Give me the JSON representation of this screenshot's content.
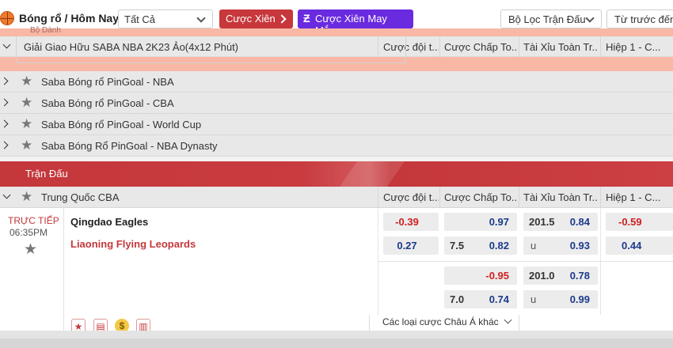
{
  "header": {
    "breadcrumb": "Bóng rổ / Hôm Nay",
    "sport_select": "Tất Cả",
    "parlay_button": "Cược Xiên",
    "lucky_parlay_button": "Cược Xiên May Mắn",
    "match_filter": "Bộ Lọc Trận Đấu",
    "sort_select": "Từ trước đến"
  },
  "expanded_league": {
    "name": "Giải Giao Hữu SABA NBA 2K23 Ảo(4x12 Phút)",
    "hint": "Bộ Dành"
  },
  "columns": [
    "Cược đội t...",
    "Cược Chấp To...",
    "Tài Xỉu Toàn Tr...",
    "Hiệp 1 - C..."
  ],
  "leagues": [
    {
      "name": "Saba Bóng rổ PinGoal - NBA"
    },
    {
      "name": "Saba Bóng rổ PinGoal - CBA"
    },
    {
      "name": "Saba Bóng rổ PinGoal - World Cup"
    },
    {
      "name": "Saba Bóng Rổ PinGoal - NBA Dynasty"
    }
  ],
  "section_title": "Trận Đấu",
  "match_league": "Trung Quốc CBA",
  "match": {
    "status": "TRỰC TIẾP",
    "time": "06:35PM",
    "home": "Qingdao Eagles",
    "away": "Liaoning Flying Leopards",
    "line1": {
      "money_home": "-0.39",
      "money_away": "0.27",
      "hcp_home_odds": "0.97",
      "hcp_away_line": "7.5",
      "hcp_away_odds": "0.82",
      "ou_line": "201.5",
      "ou_over": "0.84",
      "ou_under_label": "u",
      "ou_under": "0.93",
      "h1_home": "-0.59",
      "h1_away": "0.44"
    },
    "line2": {
      "hcp_home_odds": "-0.95",
      "hcp_away_line": "7.0",
      "hcp_away_odds": "0.74",
      "ou_line": "201.0",
      "ou_over": "0.78",
      "ou_under_label": "u",
      "ou_under": "0.99"
    },
    "other_bets": "Các loại cược Châu Á khác"
  },
  "colors": {
    "brand_red": "#c4373b",
    "lucky_purple": "#6a2ae0",
    "odds_negative": "#d11f1f",
    "odds_positive": "#1b3a8c"
  },
  "icons": [
    "basketball-icon",
    "chevron-down-icon",
    "chevron-right-icon",
    "star-icon",
    "lightning-icon",
    "stats-icon",
    "coin-icon",
    "calendar-icon"
  ]
}
